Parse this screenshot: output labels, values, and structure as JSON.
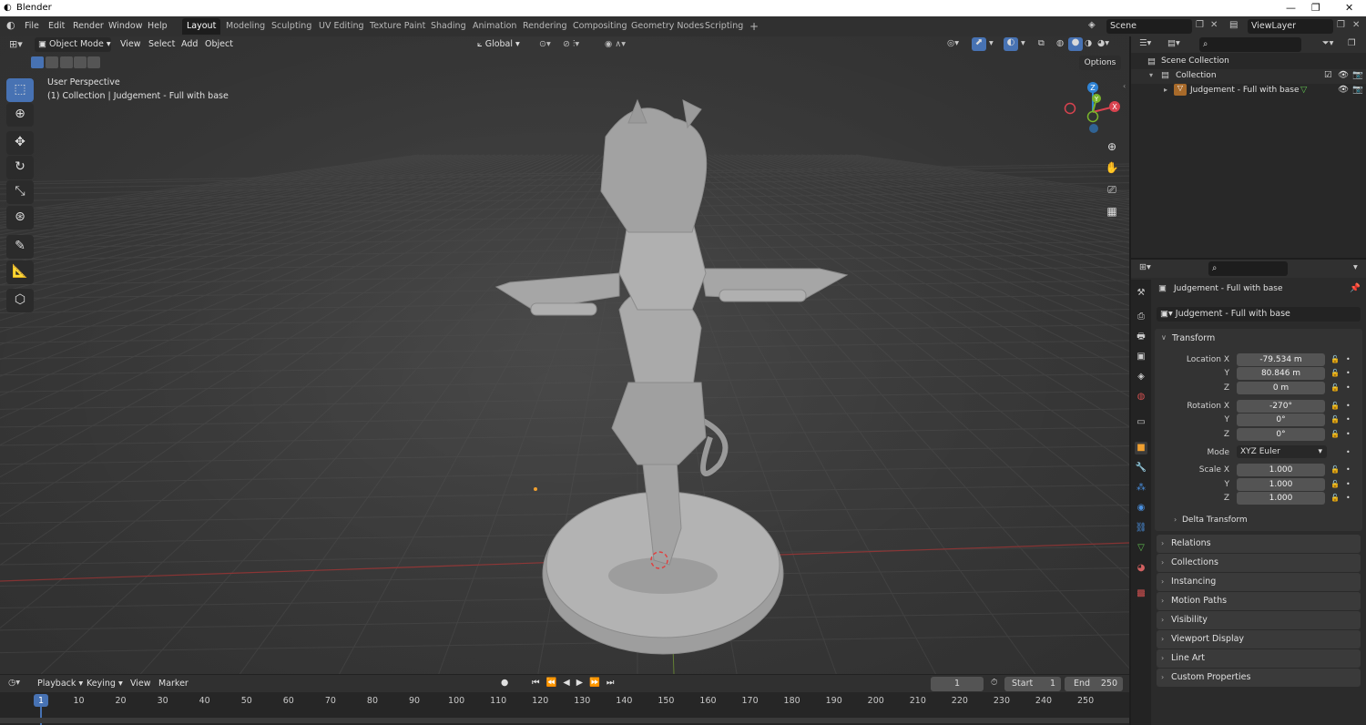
{
  "window": {
    "title": "Blender"
  },
  "menu": [
    "File",
    "Edit",
    "Render",
    "Window",
    "Help"
  ],
  "workspaces": [
    "Layout",
    "Modeling",
    "Sculpting",
    "UV Editing",
    "Texture Paint",
    "Shading",
    "Animation",
    "Rendering",
    "Compositing",
    "Geometry Nodes",
    "Scripting"
  ],
  "scene": {
    "name": "Scene",
    "view_layer": "ViewLayer"
  },
  "viewport_header": {
    "mode": "Object Mode",
    "menus": [
      "View",
      "Select",
      "Add",
      "Object"
    ],
    "transform_orientation": "Global",
    "options": "Options"
  },
  "viewport_overlay": {
    "perspective": "User Perspective",
    "collection_info": "(1) Collection | Judgement - Full with base"
  },
  "gizmo": {
    "x": "X",
    "y": "Y",
    "z": "Z"
  },
  "outliner": {
    "root": "Scene Collection",
    "collection": "Collection",
    "object": "Judgement - Full with base"
  },
  "properties": {
    "object_name": "Judgement - Full with base",
    "data_name": "Judgement - Full with base",
    "transform_title": "Transform",
    "location_label": "Location X",
    "location": {
      "x": "-79.534 m",
      "y": "80.846 m",
      "z": "0 m"
    },
    "rotation_label": "Rotation X",
    "rotation": {
      "x": "-270°",
      "y": "0°",
      "z": "0°"
    },
    "mode_label": "Mode",
    "mode": "XYZ Euler",
    "scale_label": "Scale X",
    "scale": {
      "x": "1.000",
      "y": "1.000",
      "z": "1.000"
    },
    "axis_y": "Y",
    "axis_z": "Z",
    "delta": "Delta Transform",
    "panels": [
      "Relations",
      "Collections",
      "Instancing",
      "Motion Paths",
      "Visibility",
      "Viewport Display",
      "Line Art",
      "Custom Properties"
    ]
  },
  "timeline": {
    "menus": [
      "Playback",
      "Keying",
      "View",
      "Marker"
    ],
    "current_frame": "1",
    "start_label": "Start",
    "start": "1",
    "end_label": "End",
    "end": "250",
    "ticks": [
      "1",
      "10",
      "20",
      "30",
      "40",
      "50",
      "60",
      "70",
      "80",
      "90",
      "100",
      "110",
      "120",
      "130",
      "140",
      "150",
      "160",
      "170",
      "180",
      "190",
      "200",
      "210",
      "220",
      "230",
      "240",
      "250"
    ]
  },
  "colors": {
    "accent": "#4772b3",
    "panel": "#303030",
    "viewport": "#3d3d3d",
    "x_axis": "#d8434f",
    "y_axis": "#7ab52b",
    "z_axis": "#2f83d5"
  }
}
